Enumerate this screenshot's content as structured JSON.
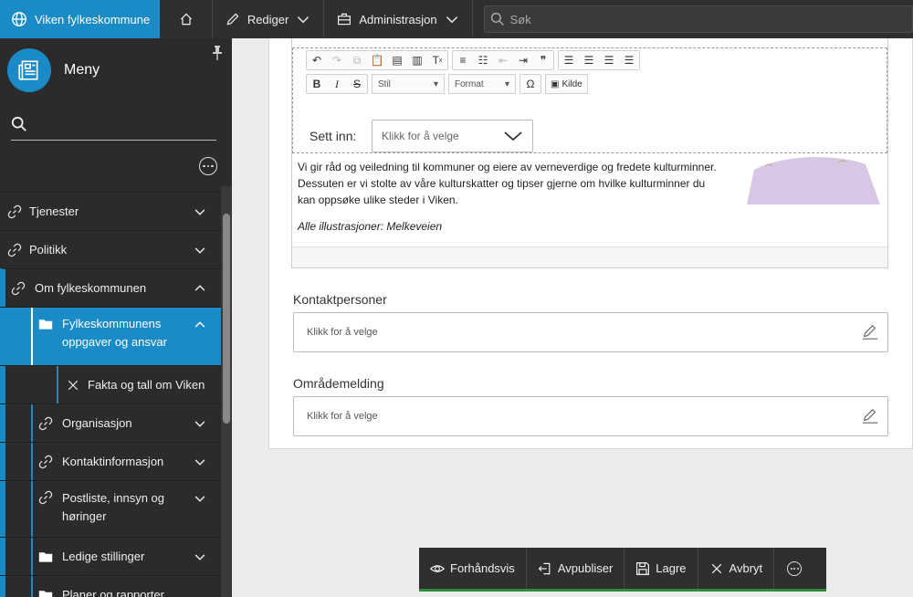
{
  "topbar": {
    "site_name": "Viken fylkeskommune",
    "edit_label": "Rediger",
    "admin_label": "Administrasjon",
    "search_placeholder": "Søk"
  },
  "sidebar": {
    "menu_title": "Meny",
    "items": [
      {
        "label": "Tjenester"
      },
      {
        "label": "Politikk"
      },
      {
        "label": "Om fylkeskommunen"
      },
      {
        "label_line1": "Fylkeskommunens",
        "label_line2": "oppgaver og ansvar"
      },
      {
        "label": "Fakta og tall om Viken"
      },
      {
        "label": "Organisasjon"
      },
      {
        "label": "Kontaktinformasjon"
      },
      {
        "label_line1": "Postliste, innsyn og",
        "label_line2": "høringer"
      },
      {
        "label": "Ledige stillinger"
      },
      {
        "label": "Planer og rapporter"
      }
    ]
  },
  "editor": {
    "style_select": "Stil",
    "format_select": "Format",
    "source_button": "Kilde",
    "insert_label": "Sett inn:",
    "insert_placeholder": "Klikk for å velge",
    "body_text": "Vi gir råd og veiledning til kommuner og eiere av verneverdige og fredete kulturminner. Dessuten er vi stolte av våre kulturskatter og tipser gjerne om hvilke kulturminner du kan oppsøke ulike steder i Viken.",
    "caption": "Alle illustrasjoner: Melkeveien"
  },
  "fields": {
    "contacts_label": "Kontaktpersoner",
    "contacts_placeholder": "Klikk for å velge",
    "area_label": "Områdemelding",
    "area_placeholder": "Klikk for å velge"
  },
  "actions": {
    "preview": "Forhåndsvis",
    "unpublish": "Avpubliser",
    "save": "Lagre",
    "cancel": "Avbryt"
  },
  "colors": {
    "brand": "#1a8bc7",
    "dark": "#2b2b2b",
    "save_accent": "#2e8b3e"
  }
}
